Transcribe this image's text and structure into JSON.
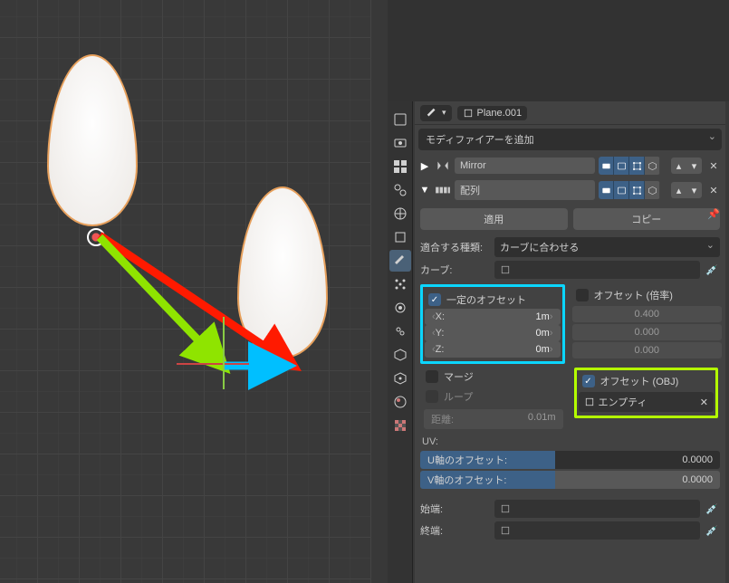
{
  "header": {
    "object_name": "Plane.001"
  },
  "add_modifier": "モディファイアーを追加",
  "modifiers": [
    {
      "name": "Mirror",
      "expanded": false
    },
    {
      "name": "配列",
      "expanded": true
    }
  ],
  "apply_btn": "適用",
  "copy_btn": "コピー",
  "fit_type_label": "適合する種類:",
  "fit_type_value": "カーブに合わせる",
  "curve_label": "カーブ:",
  "constant_offset": {
    "label": "一定のオフセット",
    "checked": true,
    "x_label": "X:",
    "x_value": "1m",
    "y_label": "Y:",
    "y_value": "0m",
    "z_label": "Z:",
    "z_value": "0m"
  },
  "relative_offset": {
    "label": "オフセット (倍率)",
    "checked": false,
    "x": "0.400",
    "y": "0.000",
    "z": "0.000"
  },
  "merge_label": "マージ",
  "loop_label": "ループ",
  "distance_label": "距離:",
  "distance_value": "0.01m",
  "object_offset": {
    "label": "オフセット (OBJ)",
    "checked": true,
    "value": "エンプティ"
  },
  "uv_label": "UV:",
  "u_offset_label": "U軸のオフセット:",
  "u_offset_value": "0.0000",
  "v_offset_label": "V軸のオフセット:",
  "v_offset_value": "0.0000",
  "start_cap_label": "始端:",
  "end_cap_label": "終端:",
  "pin_icon": "📌"
}
